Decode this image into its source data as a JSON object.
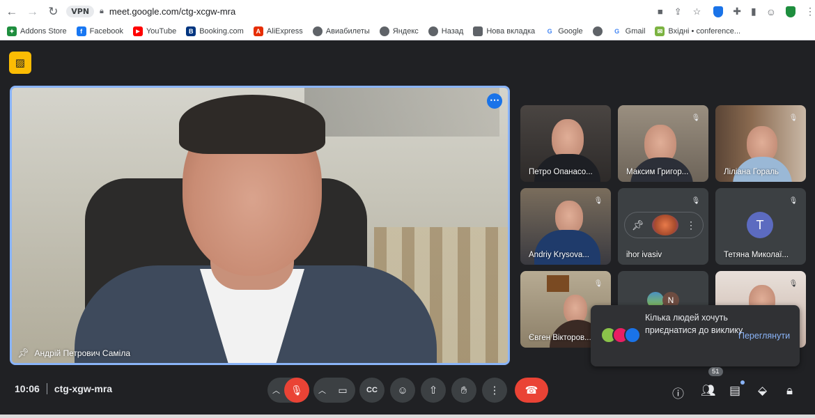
{
  "browser": {
    "vpn_label": "VPN",
    "url": "meet.google.com/ctg-xcgw-mra",
    "bookmarks": [
      {
        "label": "Addons Store",
        "color": "#1e8e3e",
        "glyph": "✦"
      },
      {
        "label": "Facebook",
        "color": "#1877f2",
        "glyph": "f"
      },
      {
        "label": "YouTube",
        "color": "#ff0000",
        "glyph": "▶"
      },
      {
        "label": "Booking.com",
        "color": "#003580",
        "glyph": "B"
      },
      {
        "label": "AliExpress",
        "color": "#e62e04",
        "glyph": "A"
      },
      {
        "label": "Авиабилеты",
        "color": "#5f6368",
        "glyph": "◍"
      },
      {
        "label": "Яндекс",
        "color": "#5f6368",
        "glyph": "◍"
      },
      {
        "label": "Назад",
        "color": "#5f6368",
        "glyph": "◍"
      },
      {
        "label": "Нова вкладка",
        "color": "#5f6368",
        "glyph": "▪"
      },
      {
        "label": "Google",
        "color": "#4285f4",
        "glyph": "G"
      },
      {
        "label": "",
        "color": "#5f6368",
        "glyph": "◍"
      },
      {
        "label": "Gmail",
        "color": "#4285f4",
        "glyph": "G"
      },
      {
        "label": "Вхідні • conference...",
        "color": "#7cb342",
        "glyph": "✉"
      }
    ]
  },
  "meet": {
    "main_speaker": "Андрій Петрович Саміла",
    "tiles": [
      {
        "name": "Петро Опанасо..."
      },
      {
        "name": "Максим Григор..."
      },
      {
        "name": "Ліліана Гораль"
      },
      {
        "name": "Andriy Krysova..."
      },
      {
        "name": "ihor ivasiv"
      },
      {
        "name": "Тетяна Миколаї..."
      },
      {
        "name": "Євген Вікторов..."
      },
      {
        "name": ""
      },
      {
        "name": ""
      }
    ],
    "avatar_letter_t": "T",
    "avatar_letter_n": "N",
    "toast": {
      "text": "Кілька людей хочуть приєднатися до виклику",
      "action": "Переглянути"
    },
    "time": "10:06",
    "meeting_code": "ctg-xgw-mra",
    "participants_count": "51"
  }
}
